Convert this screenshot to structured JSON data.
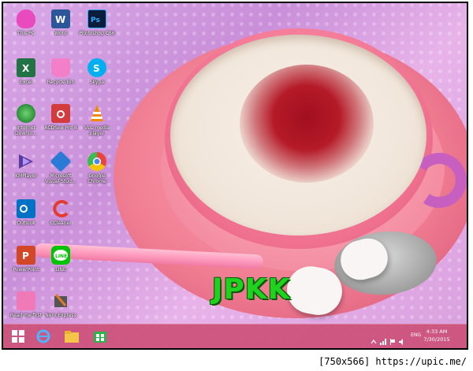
{
  "desktop": {
    "icons": [
      {
        "label": "This PC",
        "icon": "this-pc-icon",
        "color": "#e94bbf"
      },
      {
        "label": "Word",
        "icon": "word-icon",
        "color": "#2b579a"
      },
      {
        "label": "Photoshop CS6",
        "icon": "photoshop-icon",
        "color": "#0a1e3c"
      },
      {
        "label": "Excel",
        "icon": "excel-icon",
        "color": "#217346"
      },
      {
        "label": "Recycle Bin",
        "icon": "recycle-bin-icon",
        "color": "#f27fc7"
      },
      {
        "label": "Skype",
        "icon": "skype-icon",
        "color": "#00aff0"
      },
      {
        "label": "Internet Downlo...",
        "icon": "idm-icon",
        "color": "#2a8e3a"
      },
      {
        "label": "ACDSee Pro 8",
        "icon": "acdsee-icon",
        "color": "#d33c3c"
      },
      {
        "label": "VLC media player",
        "icon": "vlc-icon",
        "color": "#f08a00"
      },
      {
        "label": "KMPlayer",
        "icon": "kmplayer-icon",
        "color": "#5a3ca0"
      },
      {
        "label": "Microsoft Visual Stud...",
        "icon": "visual-studio-icon",
        "color": "#2b7bd6"
      },
      {
        "label": "Google Chrome",
        "icon": "chrome-icon",
        "color": "#e8453c"
      },
      {
        "label": "Outlook",
        "icon": "outlook-icon",
        "color": "#0072c6"
      },
      {
        "label": "CCleaner",
        "icon": "ccleaner-icon",
        "color": "#e33b2f"
      },
      {
        "label": "PowerPoint",
        "icon": "powerpoint-icon",
        "color": "#d24726"
      },
      {
        "label": "LINE",
        "icon": "line-icon",
        "color": "#00c300"
      },
      {
        "label": "Read me first",
        "icon": "readme-icon",
        "color": "#f07ab7"
      },
      {
        "label": "Nero Express",
        "icon": "nero-icon",
        "color": "#333333"
      }
    ]
  },
  "wallpaper": {
    "watermark_text": "JPKK",
    "watermark_color": "#1ed21e"
  },
  "taskbar": {
    "start_icon": "windows-start-icon",
    "pinned": [
      "internet-explorer-icon",
      "file-explorer-icon",
      "store-icon"
    ],
    "tray": {
      "language": "ENG",
      "time": "4:33 AM",
      "date": "7/30/2015"
    }
  },
  "footer": {
    "caption": "[750x566] https://upic.me/"
  }
}
